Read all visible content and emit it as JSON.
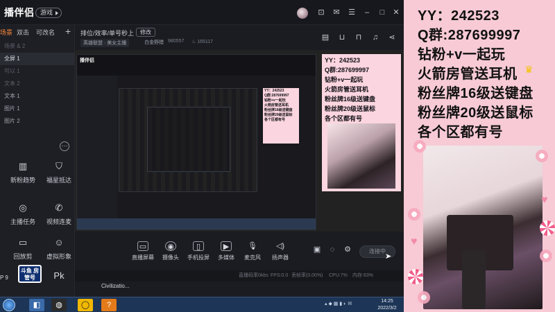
{
  "app": {
    "logo": "播伴侣",
    "logo_badge": "游戏",
    "title_icons": [
      "avatar",
      "message-icon",
      "mail-icon",
      "minimize-icon",
      "maximize-icon",
      "close-icon"
    ]
  },
  "sidebar": {
    "tabs": [
      "场景",
      "双击",
      "可改名"
    ],
    "add_label": "+",
    "sources": [
      {
        "label": "场景 & 2",
        "dim": true
      },
      {
        "label": "全屏 1",
        "dim": false
      },
      {
        "label": "可以 1",
        "dim": true
      },
      {
        "label": "文本 2",
        "dim": true
      },
      {
        "label": "文本 1",
        "dim": false
      },
      {
        "label": "图片 1",
        "dim": false
      },
      {
        "label": "图片 2",
        "dim": false
      }
    ],
    "more_label": "···",
    "tools": [
      {
        "label": "新粉趋势",
        "icon": "chart-icon"
      },
      {
        "label": "福星抵达",
        "icon": "shield-icon"
      },
      {
        "label": "主播任务",
        "icon": "task-icon"
      },
      {
        "label": "视频连麦",
        "icon": "video-icon"
      },
      {
        "label": "回放剪",
        "icon": "clip-icon"
      },
      {
        "label": "虚拟形象",
        "icon": "avatar-icon"
      },
      {
        "label": "",
        "icon": "scan-icon"
      },
      {
        "label": "",
        "icon": "pk-icon"
      }
    ]
  },
  "info": {
    "title": "排位/效率/单号秒上",
    "edit_label": "修改",
    "category": "英雄联盟 · 美女主播",
    "tag": "白金野猎",
    "room_id": "980557",
    "hot": "165117"
  },
  "preview": {
    "inner_logo": "播伴侣",
    "panel_lines_small": [
      "YY：242523",
      "Q群:287699997",
      "钻粉+v一起玩",
      "火箭房管送耳机",
      "粉丝牌16级送键盘",
      "粉丝牌20级送鼠标",
      "各个区都有号"
    ]
  },
  "controls": {
    "items": [
      {
        "label": "直播屏幕",
        "icon": "screen-share-icon"
      },
      {
        "label": "摄像头",
        "icon": "camera-icon"
      },
      {
        "label": "手机投屏",
        "icon": "phone-cast-icon"
      },
      {
        "label": "多媒体",
        "icon": "media-icon"
      },
      {
        "label": "麦克风",
        "icon": "microphone-icon"
      },
      {
        "label": "扬声器",
        "icon": "speaker-icon"
      }
    ],
    "live_button": "连接中"
  },
  "status": {
    "items": [
      "直播码率0kbs",
      "FPS:0.0",
      "丢帧率(0.00%)",
      "CPU:7%",
      "内存:63%"
    ]
  },
  "overlay": {
    "left_text": "P 9",
    "watermark": "斗鱼 房管号"
  },
  "taskbar": {
    "task_label": "Civilizatio...",
    "clock_time": "14:25",
    "clock_date": "2022/3/2"
  },
  "panel": {
    "lines": [
      "YY：242523",
      "Q群:287699997",
      "钻粉+v一起玩",
      "火箭房管送耳机",
      "粉丝牌16级送键盘",
      "粉丝牌20级送鼠标",
      "各个区都有号"
    ],
    "colors": {
      "background": "#f7cad5",
      "text": "#111111",
      "crown": "#f5c400"
    }
  }
}
